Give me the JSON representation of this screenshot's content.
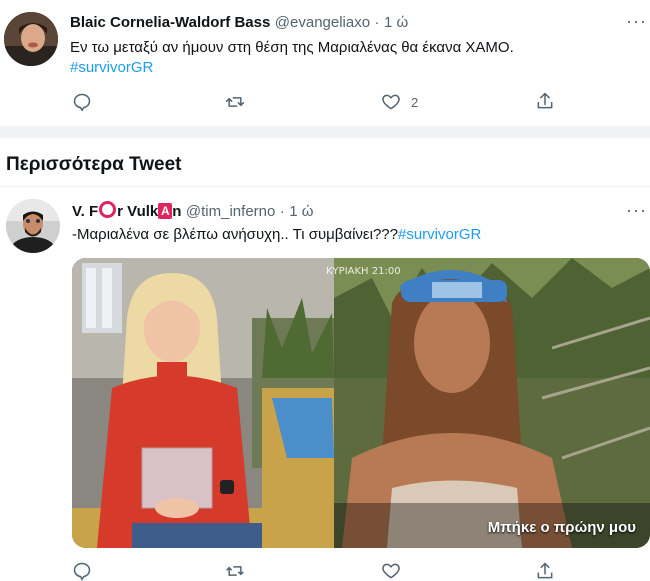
{
  "tweet1": {
    "author_name": "Blaic Cornelia-Waldorf Bass",
    "handle": "@evangeliaxo",
    "dot": "·",
    "time": "1 ώ",
    "text": "Εν τω μεταξύ αν ήμουν στη θέση της Μαριαλένας θα έκανα ΧΑΜΟ.",
    "hashtag": "#survivorGR",
    "likes": "2",
    "icons": [
      "reply-icon",
      "retweet-icon",
      "heart-icon",
      "share-icon",
      "more-icon"
    ]
  },
  "section": {
    "title": "Περισσότερα Tweet"
  },
  "tweet2": {
    "name_part1": "V. F",
    "name_part2": "r Vulk",
    "name_part3": "n",
    "boxed_letter": "A",
    "handle": "@tim_inferno",
    "dot": "·",
    "time": "1 ώ",
    "text": "-Μαριαλένα σε βλέπω ανήσυχη.. Τι συμβαίνει???",
    "hashtag": "#survivorGR",
    "media": {
      "overlay_top": "ΚΥΡΙΑΚΗ 21:00",
      "caption": "Μπήκε ο πρώην μου"
    },
    "icons": [
      "reply-icon",
      "retweet-icon",
      "heart-icon",
      "share-icon",
      "more-icon"
    ]
  },
  "colors": {
    "accent": "#1d9bf0",
    "secondary_text": "#536471",
    "divider": "#eff3f4",
    "brand_red": "#e0245e"
  }
}
